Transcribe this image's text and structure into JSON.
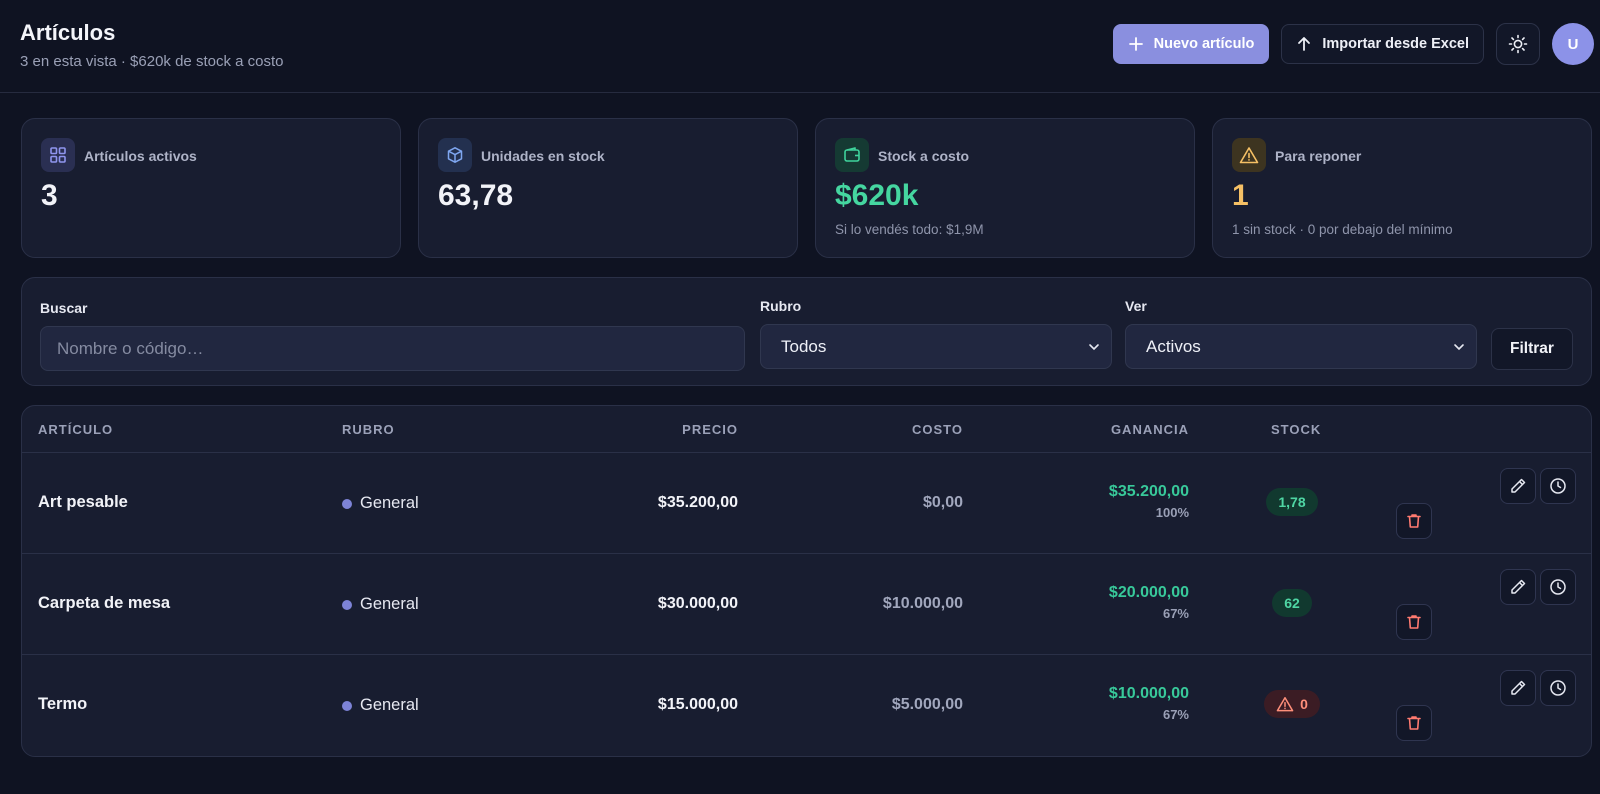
{
  "header": {
    "title": "Artículos",
    "subtitle": "3 en esta vista · $620k de stock a costo",
    "new_label": "Nuevo artículo",
    "import_label": "Importar desde Excel",
    "avatar_initial": "U"
  },
  "stats": [
    {
      "label": "Artículos activos",
      "value": "3",
      "note": "",
      "value_color": "#f2f3f8",
      "icon": "grid-icon"
    },
    {
      "label": "Unidades en stock",
      "value": "63,78",
      "note": "",
      "value_color": "#f2f3f8",
      "icon": "box-icon"
    },
    {
      "label": "Stock a costo",
      "value": "$620k",
      "note": "Si lo vendés todo: $1,9M",
      "value_color": "#45d6a0",
      "icon": "wallet-icon"
    },
    {
      "label": "Para reponer",
      "value": "1",
      "note": "1 sin stock · 0 por debajo del mínimo",
      "value_color": "#f5c065",
      "icon": "warning-icon"
    }
  ],
  "filters": {
    "search_label": "Buscar",
    "search_placeholder": "Nombre o código…",
    "rubro_label": "Rubro",
    "rubro_value": "Todos",
    "ver_label": "Ver",
    "ver_value": "Activos",
    "filter_button": "Filtrar"
  },
  "table": {
    "headers": {
      "articulo": "ARTÍCULO",
      "rubro": "RUBRO",
      "precio": "PRECIO",
      "costo": "COSTO",
      "ganancia": "GANANCIA",
      "stock": "STOCK"
    },
    "rows": [
      {
        "name": "Art pesable",
        "rubro": "General",
        "precio": "$35.200,00",
        "costo": "$0,00",
        "ganancia": "$35.200,00",
        "ganancia_pct": "100%",
        "stock": "1,78",
        "stock_status": "ok"
      },
      {
        "name": "Carpeta de mesa",
        "rubro": "General",
        "precio": "$30.000,00",
        "costo": "$10.000,00",
        "ganancia": "$20.000,00",
        "ganancia_pct": "67%",
        "stock": "62",
        "stock_status": "ok"
      },
      {
        "name": "Termo",
        "rubro": "General",
        "precio": "$15.000,00",
        "costo": "$5.000,00",
        "ganancia": "$10.000,00",
        "ganancia_pct": "67%",
        "stock": "0",
        "stock_status": "out"
      }
    ]
  },
  "colors": {
    "background": "#0f1322",
    "card": "#181d30",
    "accent": "#8a8fdf",
    "positive": "#38c99a",
    "warning": "#f5c065",
    "danger": "#ff8f7a"
  }
}
